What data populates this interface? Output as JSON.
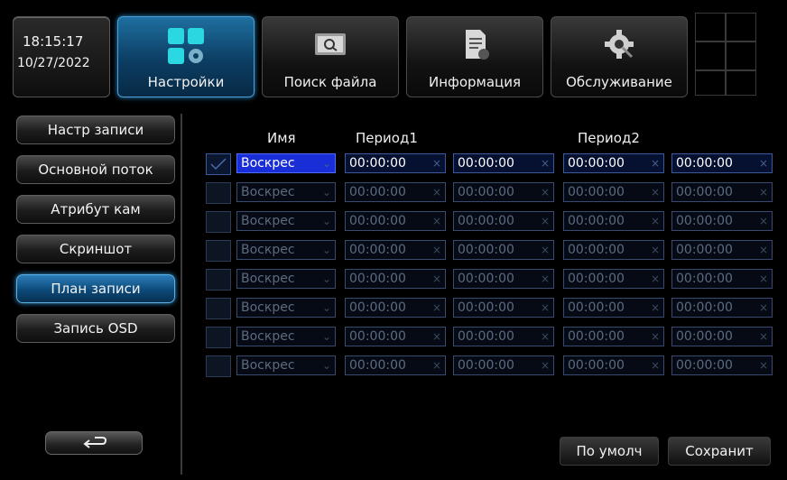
{
  "clock": {
    "time": "18:15:17",
    "date": "10/27/2022"
  },
  "tabs": [
    {
      "label": "Настройки",
      "icon": "settings-icon",
      "active": true
    },
    {
      "label": "Поиск файла",
      "icon": "file-search-icon",
      "active": false
    },
    {
      "label": "Информация",
      "icon": "information-icon",
      "active": false
    },
    {
      "label": "Обслуживание",
      "icon": "maintenance-gear-icon",
      "active": false
    }
  ],
  "menu": [
    {
      "label": "Настр записи",
      "active": false
    },
    {
      "label": "Основной поток",
      "active": false
    },
    {
      "label": "Атрибут кам",
      "active": false
    },
    {
      "label": "Скриншот",
      "active": false
    },
    {
      "label": "План записи",
      "active": true
    },
    {
      "label": "Запись OSD",
      "active": false
    }
  ],
  "back_icon": "return-arrow-icon",
  "schedule": {
    "headers": {
      "name": "Имя",
      "period1": "Период1",
      "period2": "Период2"
    },
    "rows": [
      {
        "day": "Воскрес",
        "p1_start": "00:00:00",
        "p1_end": "00:00:00",
        "p2_start": "00:00:00",
        "p2_end": "00:00:00",
        "enabled": true
      },
      {
        "day": "Воскрес",
        "p1_start": "00:00:00",
        "p1_end": "00:00:00",
        "p2_start": "00:00:00",
        "p2_end": "00:00:00",
        "enabled": false
      },
      {
        "day": "Воскрес",
        "p1_start": "00:00:00",
        "p1_end": "00:00:00",
        "p2_start": "00:00:00",
        "p2_end": "00:00:00",
        "enabled": false
      },
      {
        "day": "Воскрес",
        "p1_start": "00:00:00",
        "p1_end": "00:00:00",
        "p2_start": "00:00:00",
        "p2_end": "00:00:00",
        "enabled": false
      },
      {
        "day": "Воскрес",
        "p1_start": "00:00:00",
        "p1_end": "00:00:00",
        "p2_start": "00:00:00",
        "p2_end": "00:00:00",
        "enabled": false
      },
      {
        "day": "Воскрес",
        "p1_start": "00:00:00",
        "p1_end": "00:00:00",
        "p2_start": "00:00:00",
        "p2_end": "00:00:00",
        "enabled": false
      },
      {
        "day": "Воскрес",
        "p1_start": "00:00:00",
        "p1_end": "00:00:00",
        "p2_start": "00:00:00",
        "p2_end": "00:00:00",
        "enabled": false
      },
      {
        "day": "Воскрес",
        "p1_start": "00:00:00",
        "p1_end": "00:00:00",
        "p2_start": "00:00:00",
        "p2_end": "00:00:00",
        "enabled": false
      }
    ]
  },
  "footer": {
    "default_label": "По умолч",
    "save_label": "Сохранит"
  },
  "colors": {
    "accent_blue": "#1a2ed8",
    "active_tab": "#1e6fa0"
  }
}
